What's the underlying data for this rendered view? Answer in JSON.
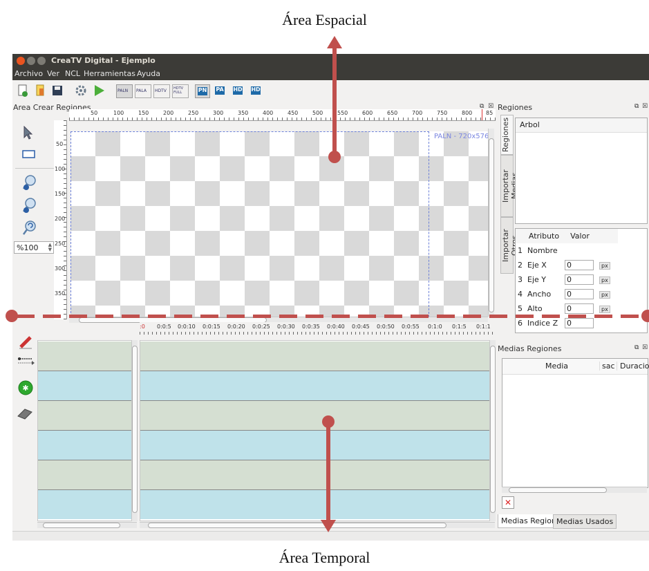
{
  "annotations": {
    "top_label": "Área Espacial",
    "bottom_label": "Área Temporal"
  },
  "window": {
    "title": "CreaTV Digital - Ejemplo",
    "menus": [
      "Archivo",
      "Ver",
      "NCL",
      "Herramientas",
      "Ayuda"
    ]
  },
  "toolbar": {
    "res_buttons": [
      "PALN",
      "PALA",
      "HDTV",
      "HDTV FULL"
    ],
    "mode_buttons": [
      "PN",
      "PA",
      "HD",
      "HD"
    ]
  },
  "spatial": {
    "panel_title": "Area Crear Regiones",
    "h_ticks": [
      "50",
      "100",
      "150",
      "200",
      "250",
      "300",
      "350",
      "400",
      "450",
      "500",
      "550",
      "600",
      "650",
      "700",
      "750",
      "800",
      "85"
    ],
    "v_ticks": [
      "50",
      "100",
      "150",
      "200",
      "250",
      "300",
      "350"
    ],
    "zoom_value": "%100",
    "canvas_label": "PALN - 720x576"
  },
  "regiones": {
    "panel_title": "Regiones",
    "tabs": [
      "Regiones",
      "Importar Medias",
      "Importar Otros"
    ],
    "tree_header": "Arbol",
    "attr_headers": [
      "Atributo",
      "Valor"
    ],
    "attributes": [
      {
        "num": "1",
        "name": "Nombre",
        "value": "",
        "unit": ""
      },
      {
        "num": "2",
        "name": "Eje X",
        "value": "0",
        "unit": "px"
      },
      {
        "num": "3",
        "name": "Eje Y",
        "value": "0",
        "unit": "px"
      },
      {
        "num": "4",
        "name": "Ancho",
        "value": "0",
        "unit": "px"
      },
      {
        "num": "5",
        "name": "Alto",
        "value": "0",
        "unit": "px"
      },
      {
        "num": "6",
        "name": "Indice Z",
        "value": "0",
        "unit": ""
      }
    ]
  },
  "temporal": {
    "time_ticks": [
      ":0",
      "0:0:5",
      "0:0:10",
      "0:0:15",
      "0:0:20",
      "0:0:25",
      "0:0:30",
      "0:0:35",
      "0:0:40",
      "0:0:45",
      "0:0:50",
      "0:0:55",
      "0:1:0",
      "0:1:5",
      "0:1:1"
    ]
  },
  "medias": {
    "panel_title": "Medias Regiones",
    "col_headers": [
      "Media",
      "sac",
      "Duracio"
    ],
    "bottom_tabs": [
      "Medias Region",
      "Medias Usados"
    ]
  },
  "colors": {
    "accent_red": "#c0504d",
    "track_green": "#d5dfd2",
    "track_blue": "#bfe2ea",
    "titlebar": "#3c3b37"
  }
}
